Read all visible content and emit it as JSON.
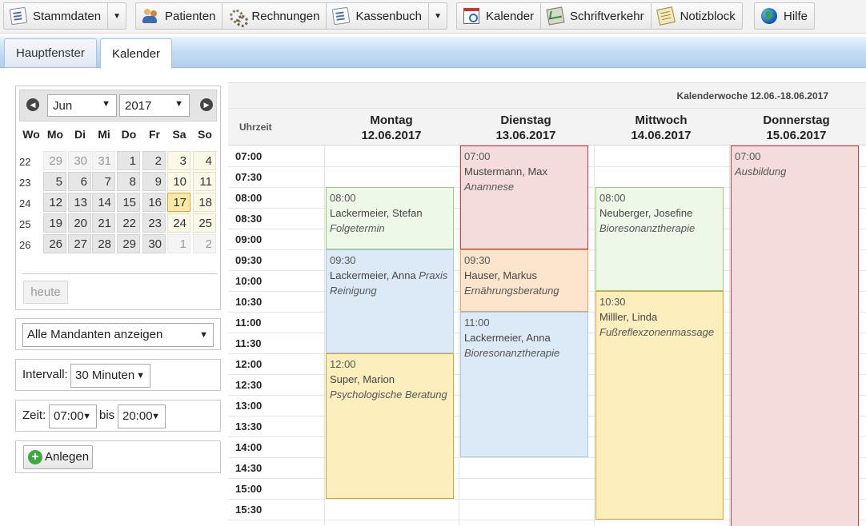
{
  "toolbar": {
    "stammdaten": "Stammdaten",
    "patienten": "Patienten",
    "rechnungen": "Rechnungen",
    "kassenbuch": "Kassenbuch",
    "kalender": "Kalender",
    "schriftverkehr": "Schriftverkehr",
    "notizblock": "Notizblock",
    "hilfe": "Hilfe"
  },
  "tabs": [
    {
      "label": "Hauptfenster",
      "active": false
    },
    {
      "label": "Kalender",
      "active": true
    }
  ],
  "datepicker": {
    "month": "Jun",
    "year": "2017",
    "weekdays": [
      "Wo",
      "Mo",
      "Di",
      "Mi",
      "Do",
      "Fr",
      "Sa",
      "So"
    ],
    "weeks": [
      {
        "week": "22",
        "days": [
          "29",
          "30",
          "31",
          "1",
          "2",
          "3",
          "4"
        ]
      },
      {
        "week": "23",
        "days": [
          "5",
          "6",
          "7",
          "8",
          "9",
          "10",
          "11"
        ]
      },
      {
        "week": "24",
        "days": [
          "12",
          "13",
          "14",
          "15",
          "16",
          "17",
          "18"
        ]
      },
      {
        "week": "25",
        "days": [
          "19",
          "20",
          "21",
          "22",
          "23",
          "24",
          "25"
        ]
      },
      {
        "week": "26",
        "days": [
          "26",
          "27",
          "28",
          "29",
          "30",
          "1",
          "2"
        ]
      }
    ],
    "today_label": "heute"
  },
  "mandanten": "Alle Mandanten anzeigen",
  "intervall": {
    "label": "Intervall:",
    "value": "30 Minuten"
  },
  "zeit": {
    "label": "Zeit:",
    "from": "07:00",
    "to_label": "bis",
    "to": "20:00"
  },
  "add_label": "Anlegen",
  "calendar": {
    "week_label": "Kalenderwoche 12.06.-18.06.2017",
    "time_header": "Uhrzeit",
    "columns": [
      {
        "day": "Montag",
        "date": "12.06.2017"
      },
      {
        "day": "Dienstag",
        "date": "13.06.2017"
      },
      {
        "day": "Mittwoch",
        "date": "14.06.2017"
      },
      {
        "day": "Donnerstag",
        "date": "15.06.2017"
      }
    ],
    "times": [
      "07:00",
      "07:30",
      "08:00",
      "08:30",
      "09:00",
      "09:30",
      "10:00",
      "10:30",
      "11:00",
      "11:30",
      "12:00",
      "12:30",
      "13:00",
      "13:30",
      "14:00",
      "14:30",
      "15:00",
      "15:30"
    ],
    "events": [
      {
        "col": 0,
        "start": "08:00",
        "end": "09:30",
        "color": "green",
        "time": "08:00",
        "name": "Lackermeier, Stefan",
        "desc": "Folgetermin"
      },
      {
        "col": 0,
        "start": "09:30",
        "end": "12:00",
        "color": "blue",
        "time": "09:30",
        "name": "Lackermeier, Anna",
        "desc": "Praxis Reinigung"
      },
      {
        "col": 0,
        "start": "12:00",
        "end": "15:30",
        "color": "yellow",
        "time": "12:00",
        "name": "Super, Marion",
        "desc": "Psychologische Beratung"
      },
      {
        "col": 1,
        "start": "07:00",
        "end": "09:30",
        "color": "red",
        "time": "07:00",
        "name": "Mustermann, Max",
        "desc": "Anamnese"
      },
      {
        "col": 1,
        "start": "09:30",
        "end": "11:00",
        "color": "orange",
        "time": "09:30",
        "name": "Hauser, Markus",
        "desc": "Ernährungsberatung"
      },
      {
        "col": 1,
        "start": "11:00",
        "end": "14:30",
        "color": "blue",
        "time": "11:00",
        "name": "Lackermeier, Anna",
        "desc": "Bioresonanztherapie"
      },
      {
        "col": 2,
        "start": "08:00",
        "end": "10:30",
        "color": "green",
        "time": "08:00",
        "name": "Neuberger, Josefine",
        "desc": "Bioresonanztherapie"
      },
      {
        "col": 2,
        "start": "10:30",
        "end": "16:00",
        "color": "yellow",
        "time": "10:30",
        "name": "Milller, Linda",
        "desc": "Fußreflexzonenmassage"
      },
      {
        "col": 3,
        "start": "07:00",
        "end": "16:30",
        "color": "red",
        "time": "07:00",
        "name": "",
        "desc": "Ausbildung"
      }
    ]
  }
}
